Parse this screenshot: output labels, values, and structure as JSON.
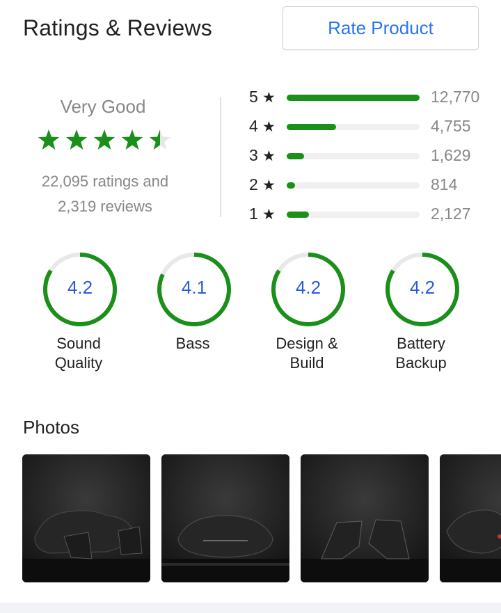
{
  "header": {
    "title": "Ratings & Reviews",
    "rate_button": "Rate Product"
  },
  "summary": {
    "verdict": "Very Good",
    "rating": 4.5,
    "ratings_line": "22,095 ratings and",
    "reviews_line": "2,319 reviews",
    "star_color": "#1a8f1a",
    "star_empty_color": "#e6e6e6"
  },
  "distribution": [
    {
      "stars": "5",
      "count": "12,770",
      "fraction": 1.0
    },
    {
      "stars": "4",
      "count": "4,755",
      "fraction": 0.37
    },
    {
      "stars": "3",
      "count": "1,629",
      "fraction": 0.13
    },
    {
      "stars": "2",
      "count": "814",
      "fraction": 0.064
    },
    {
      "stars": "1",
      "count": "2,127",
      "fraction": 0.167
    }
  ],
  "star_glyph": "★",
  "aspects": [
    {
      "value": "4.2",
      "label": [
        "Sound",
        "Quality"
      ],
      "fraction": 0.84
    },
    {
      "value": "4.1",
      "label": [
        "Bass"
      ],
      "fraction": 0.82
    },
    {
      "value": "4.2",
      "label": [
        "Design &",
        "Build"
      ],
      "fraction": 0.84
    },
    {
      "value": "4.2",
      "label": [
        "Battery",
        "Backup"
      ],
      "fraction": 0.84
    }
  ],
  "photos": {
    "title": "Photos",
    "items": [
      "earbuds-case-photo",
      "earbuds-case-closed-photo",
      "earbuds-pair-photo",
      "earbuds-partial-photo"
    ]
  },
  "colors": {
    "accent": "#2874f0",
    "green": "#1a8f1a",
    "track": "#f0f0f0",
    "ring_track": "#e8e8e8",
    "value_blue": "#2a5bd7"
  }
}
